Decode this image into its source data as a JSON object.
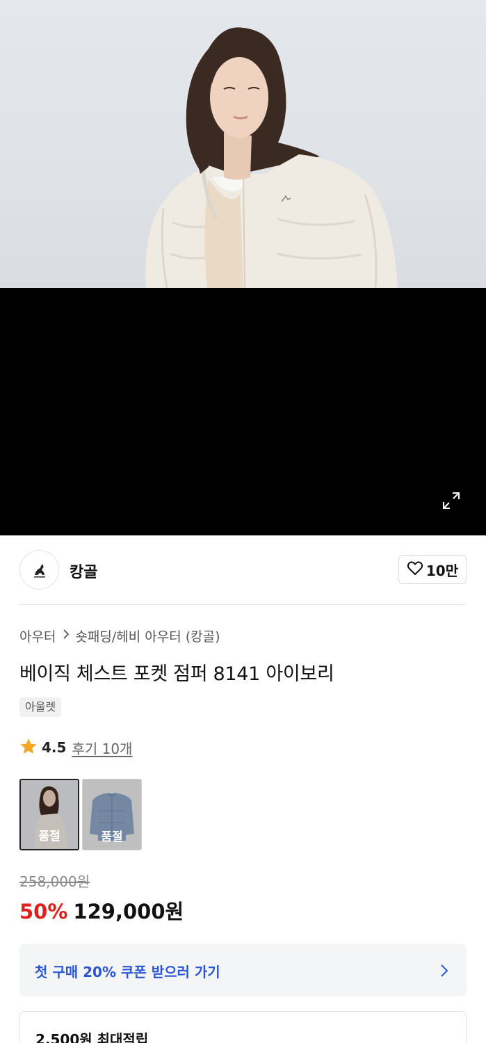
{
  "gallery": {
    "expand_icon": "expand-icon",
    "background_color": "#000000"
  },
  "brand": {
    "name": "캉골",
    "logo_icon": "kangaroo-logo-icon",
    "like_icon": "heart-outline-icon",
    "like_count": "10만"
  },
  "breadcrumb": {
    "items": [
      "아우터",
      "숏패딩/헤비 아우터 (캉골)"
    ],
    "separator_icon": "chevron-right-icon"
  },
  "product": {
    "title": "베이직 체스트 포켓 점퍼 8141 아이보리",
    "badge": "아울렛"
  },
  "rating": {
    "star_icon": "star-icon",
    "score": "4.5",
    "review_link": "후기 10개",
    "star_color": "#f5a623"
  },
  "swatches": [
    {
      "color_name": "ivory",
      "status": "품절",
      "selected": true
    },
    {
      "color_name": "blue",
      "status": "품절",
      "selected": false
    }
  ],
  "price": {
    "original": "258,000원",
    "discount": "50%",
    "sale": "129,000원",
    "discount_color": "#e0201e"
  },
  "coupon": {
    "label": "첫 구매 20% 쿠폰 받으러 가기",
    "chevron_icon": "chevron-right-icon",
    "text_color": "#2a55d6"
  },
  "points": {
    "label": "2,500원 최대적립"
  }
}
